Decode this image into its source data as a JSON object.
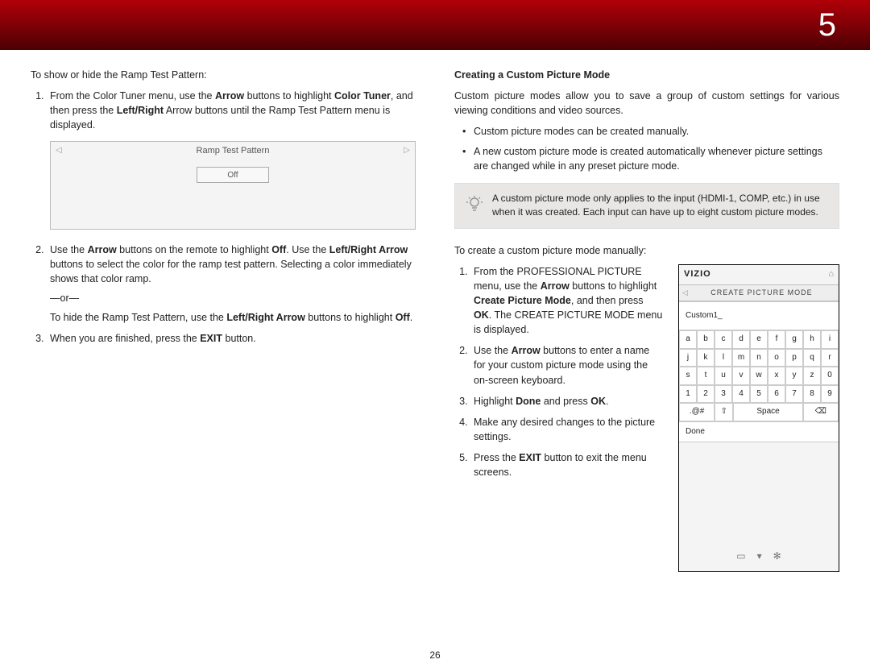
{
  "header": {
    "page_tab": "5"
  },
  "left": {
    "intro": "To show or hide the Ramp Test Pattern:",
    "s1_a": "From the Color Tuner menu, use the ",
    "s1_b": "Arrow",
    "s1_c": " buttons to highlight ",
    "s1_d": "Color Tuner",
    "s1_e": ", and then press the ",
    "s1_f": "Left/Right",
    "s1_g": " Arrow buttons until the Ramp Test Pattern menu is displayed.",
    "ramp_title": "Ramp Test Pattern",
    "ramp_off": "Off",
    "s2_a": "Use the ",
    "s2_b": "Arrow",
    "s2_c": " buttons on the remote to highlight ",
    "s2_d": "Off",
    "s2_e": ". Use the ",
    "s2_f": "Left/Right Arrow",
    "s2_g": " buttons to select the color for the ramp test pattern. Selecting a color immediately shows that color ramp.",
    "or": "—or—",
    "s2h_a": "To hide the Ramp Test Pattern, use the ",
    "s2h_b": "Left/Right Arrow",
    "s2h_c": " buttons to highlight ",
    "s2h_d": "Off",
    "s2h_e": ".",
    "s3_a": "When you are finished, press the ",
    "s3_b": "EXIT",
    "s3_c": " button."
  },
  "right": {
    "heading": "Creating a Custom Picture Mode",
    "para": "Custom picture modes allow you to save a group of custom settings for various viewing conditions and video sources.",
    "b1": "Custom picture modes can be created manually.",
    "b2": "A new custom picture mode is created automatically whenever picture settings are changed while in any preset picture mode.",
    "tip": "A custom picture mode only applies to the input (HDMI-1, COMP, etc.) in use when it was created. Each input can have up to eight custom picture modes.",
    "intro2": "To create a custom picture mode manually:",
    "s1_a": "From the PROFESSIONAL PICTURE menu, use the ",
    "s1_b": "Arrow",
    "s1_c": " buttons to highlight ",
    "s1_d": "Create Picture Mode",
    "s1_e": ", and then press ",
    "s1_f": "OK",
    "s1_g": ". The CREATE PICTURE MODE menu is displayed.",
    "s2_a": "Use the ",
    "s2_b": "Arrow",
    "s2_c": " buttons to enter a name for your custom picture mode using the on-screen keyboard.",
    "s3_a": "Highlight ",
    "s3_b": "Done",
    "s3_c": " and press ",
    "s3_d": "OK",
    "s3_e": ".",
    "s4": "Make any desired changes to the picture settings.",
    "s5_a": "Press the ",
    "s5_b": "EXIT",
    "s5_c": " button to exit the menu screens."
  },
  "screen": {
    "brand": "VIZIO",
    "sub": "CREATE PICTURE MODE",
    "field": "Custom1_",
    "rows": [
      [
        "a",
        "b",
        "c",
        "d",
        "e",
        "f",
        "g",
        "h",
        "i"
      ],
      [
        "j",
        "k",
        "l",
        "m",
        "n",
        "o",
        "p",
        "q",
        "r"
      ],
      [
        "s",
        "t",
        "u",
        "v",
        "w",
        "x",
        "y",
        "z",
        "0"
      ],
      [
        "1",
        "2",
        "3",
        "4",
        "5",
        "6",
        "7",
        "8",
        "9"
      ]
    ],
    "sym": ".@#",
    "shift": "⇧",
    "space": "Space",
    "back": "⌫",
    "done": "Done"
  },
  "footer_page": "26"
}
